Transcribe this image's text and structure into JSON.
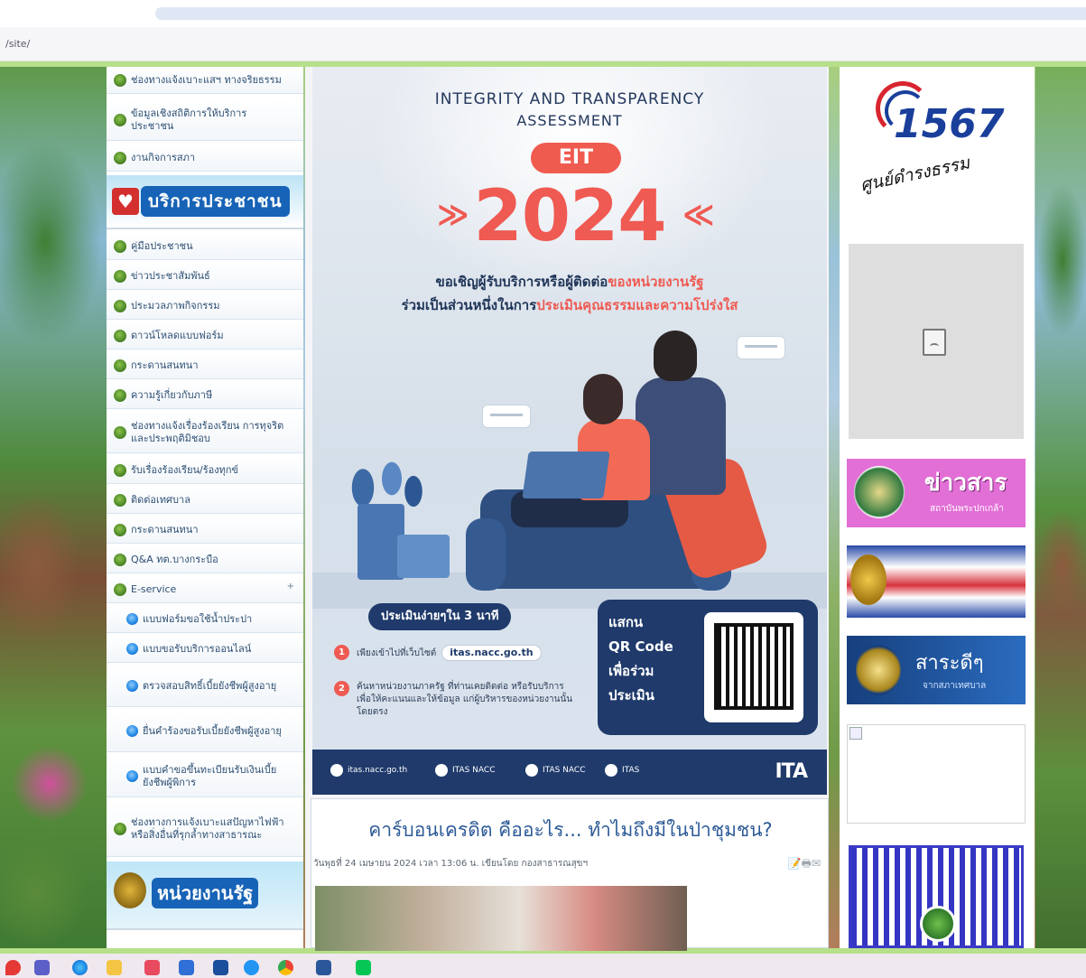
{
  "browser": {
    "url_path": "/site/"
  },
  "left_menu": {
    "top_items": [
      "ช่องทางแจ้งเบาะแสฯ ทางจริยธรรม",
      "ข้อมูลเชิงสถิติการให้บริการ ประชาชน",
      "งานกิจการสภา"
    ],
    "public_service_banner": "บริการประชาชน",
    "service_items": [
      "คู่มือประชาชน",
      "ข่าวประชาสัมพันธ์",
      "ประมวลภาพกิจกรรม",
      "ดาวน์โหลดแบบฟอร์ม",
      "กระดานสนทนา",
      "ความรู้เกี่ยวกับภาษี",
      "ช่องทางแจ้งเรื่องร้องเรียน การทุจริตและประพฤติมิชอบ",
      "รับเรื่องร้องเรียน/ร้องทุกข์",
      "ติดต่อเทศบาล",
      "กระดานสนทนา",
      "Q&A ทต.บางกระบือ",
      "E-service"
    ],
    "eservice_subitems": [
      "แบบฟอร์มขอใช้น้ำประปา",
      "แบบขอรับบริการออนไลน์",
      "ตรวจสอบสิทธิ์เบี้ยยังชีพผู้สูงอายุ",
      "ยื่นคำร้องขอรับเบี้ยยังชีพผู้สูงอายุ",
      "แบบคำขอขึ้นทะเบียนรับเงินเบี้ยยังชีพผู้พิการ"
    ],
    "last_item": "ช่องทางการแจ้งเบาะแสปัญหาไฟฟ้าหรือสิ่งอื่นที่รุกล้ำทางสาธารณะ",
    "gov_banner": "หน่วยงานรัฐ",
    "eservice_arrow": "+"
  },
  "poster": {
    "title_line1": "INTEGRITY AND TRANSPARENCY",
    "title_line2": "ASSESSMENT",
    "badge": "EIT",
    "year": "2024",
    "chevron_left": "≫",
    "chevron_right": "≪",
    "invite_line1_a": "ขอเชิญผู้รับบริการหรือผู้ติดต่อ",
    "invite_line1_b": "ของหน่วยงานรัฐ",
    "invite_line2_a": "ร่วมเป็นส่วนหนึ่งในการ",
    "invite_line2_b": "ประเมินคุณธรรมและความโปร่งใส",
    "quick_label": "ประเมินง่ายๆใน 3 นาที",
    "step1_text": "เพียงเข้าไปที่เว็บไซต์",
    "step1_url": "itas.nacc.go.th",
    "step2_text": "ค้นหาหน่วยงานภาครัฐ ที่ท่านเคยติดต่อ หรือรับบริการ เพื่อให้คะแนนและให้ข้อมูล แก่ผู้บริหารของหน่วยงานนั้นโดยตรง",
    "qr_label": [
      "แสกน",
      "QR Code",
      "เพื่อร่วม",
      "ประเมิน"
    ],
    "footer": [
      "itas.nacc.go.th",
      "ITAS NACC",
      "ITAS NACC",
      "ITAS"
    ],
    "footer_logo": "ITA",
    "colors": {
      "accent": "#ef5a52",
      "navy": "#1f3a6b"
    }
  },
  "article": {
    "title": "คาร์บอนเครดิต คืออะไร... ทำไมถึงมีในป่าชุมชน?",
    "meta": "วันพุธที่ 24 เมษายน 2024 เวลา 13:06 น. เขียนโดย กองสาธารณสุขฯ",
    "tools": "📝🖶✉"
  },
  "right_col": {
    "hotline_number": "1567",
    "hotline_script": "ศูนย์ดำรงธรรม",
    "news_title": "ข่าวสาร",
    "news_sub": "สถาบันพระปกเกล้า",
    "law_title": "สาระดีๆ",
    "law_sub": "จากสภาเทศบาล"
  },
  "taskbar": {
    "icons": [
      "security-icon",
      "teams-icon",
      "edge-icon",
      "explorer-icon",
      "store-icon",
      "app-icon",
      "zoom-icon",
      "chrome-icon",
      "word-icon",
      "line-icon"
    ]
  }
}
